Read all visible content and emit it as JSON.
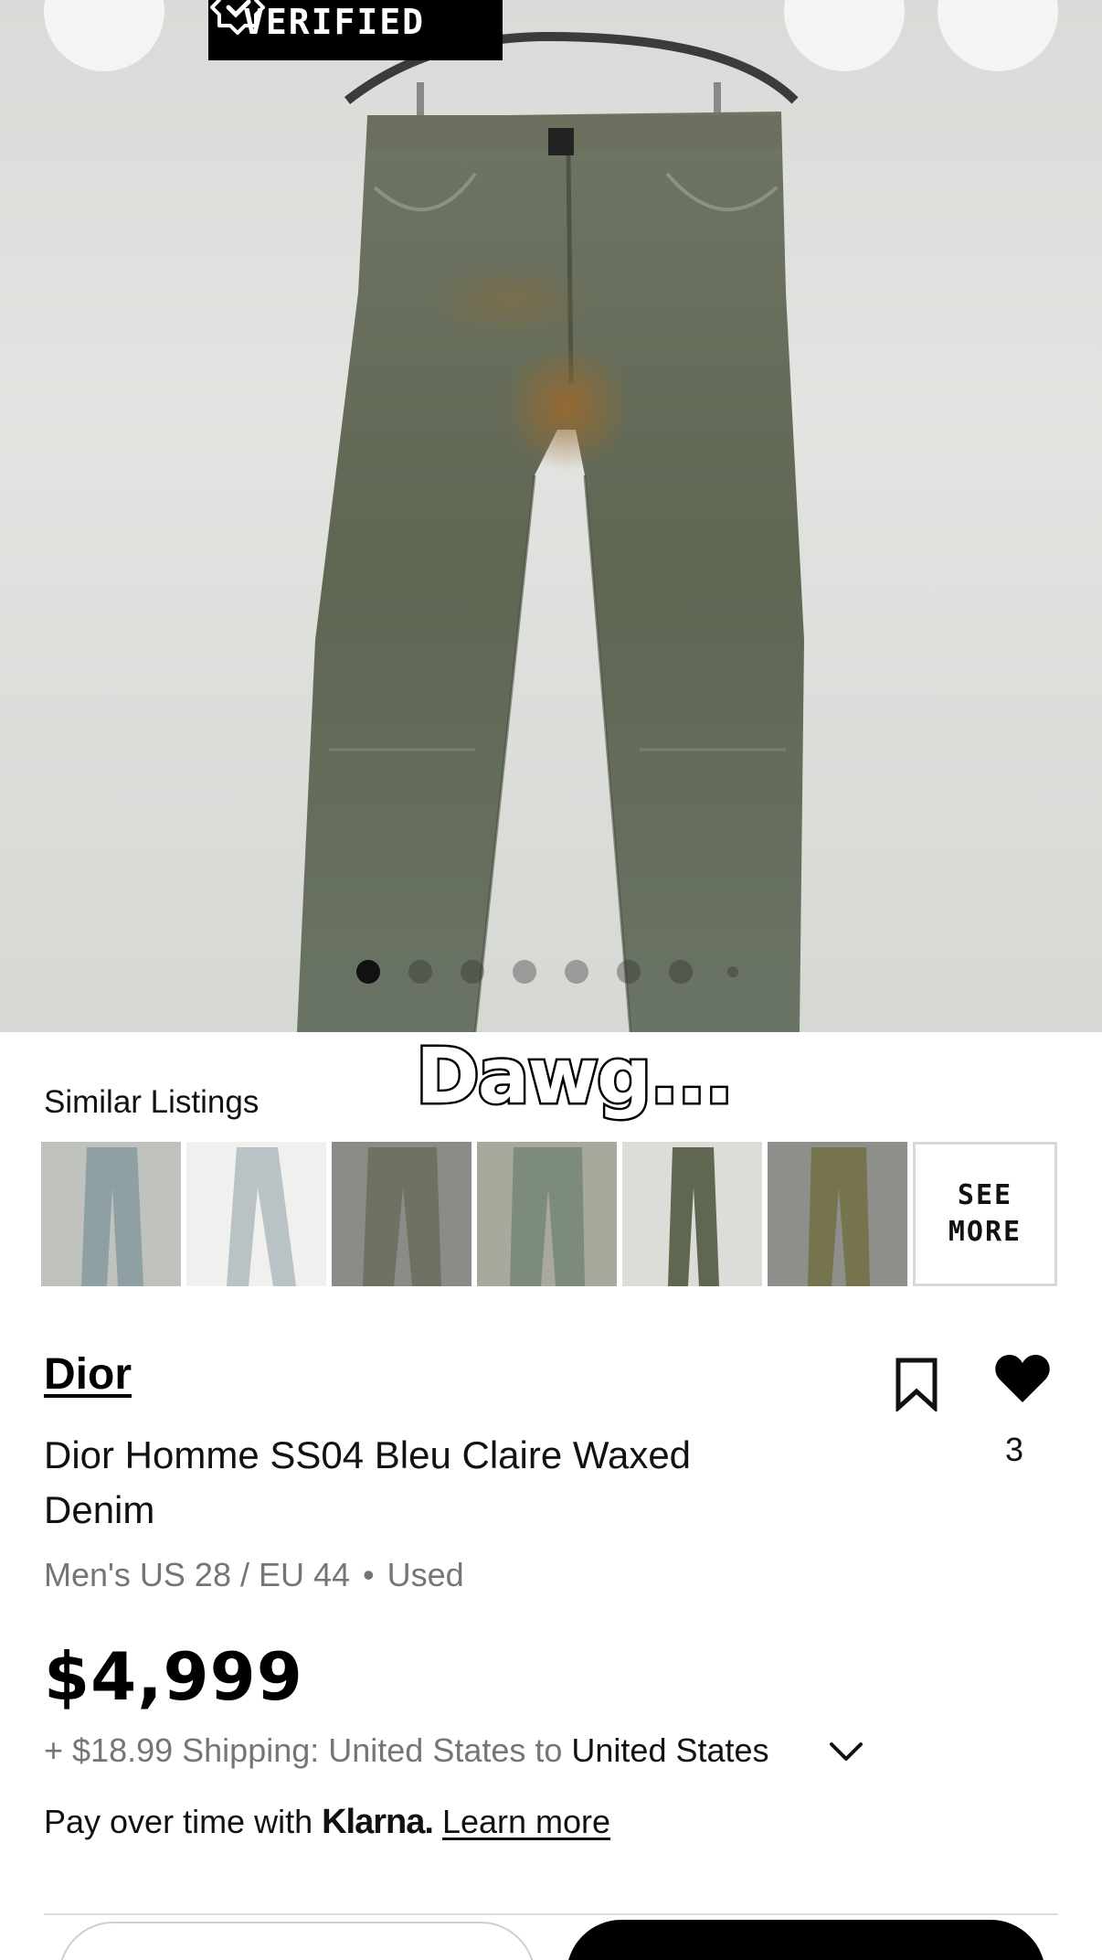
{
  "header": {
    "back_icon": "chevron-left-icon",
    "badge_label": "VERIFIED",
    "badge_icon": "verified-check-icon",
    "search_icon": "search-icon",
    "share_icon": "share-icon"
  },
  "gallery": {
    "total_images": 8,
    "active_index": 1
  },
  "caption": "Dawg...",
  "similar": {
    "title": "Similar Listings",
    "see_more": "SEE MORE",
    "thumbnail_count": 6
  },
  "product": {
    "brand": "Dior",
    "name": "Dior Homme SS04 Bleu Claire Waxed Denim",
    "size": "Men's US 28 / EU 44",
    "separator": "•",
    "condition": "Used",
    "likes": "3",
    "price": "$4,999"
  },
  "shipping": {
    "prefix": "+ $18.99 Shipping: United States to ",
    "destination": "United States"
  },
  "klarna": {
    "prefix": "Pay over time with ",
    "brand": "Klarna.",
    "link": "Learn more"
  },
  "colors": {
    "badge_bg": "#000000",
    "price": "#000000",
    "muted_text": "#757575",
    "primary_button": "#000000"
  }
}
